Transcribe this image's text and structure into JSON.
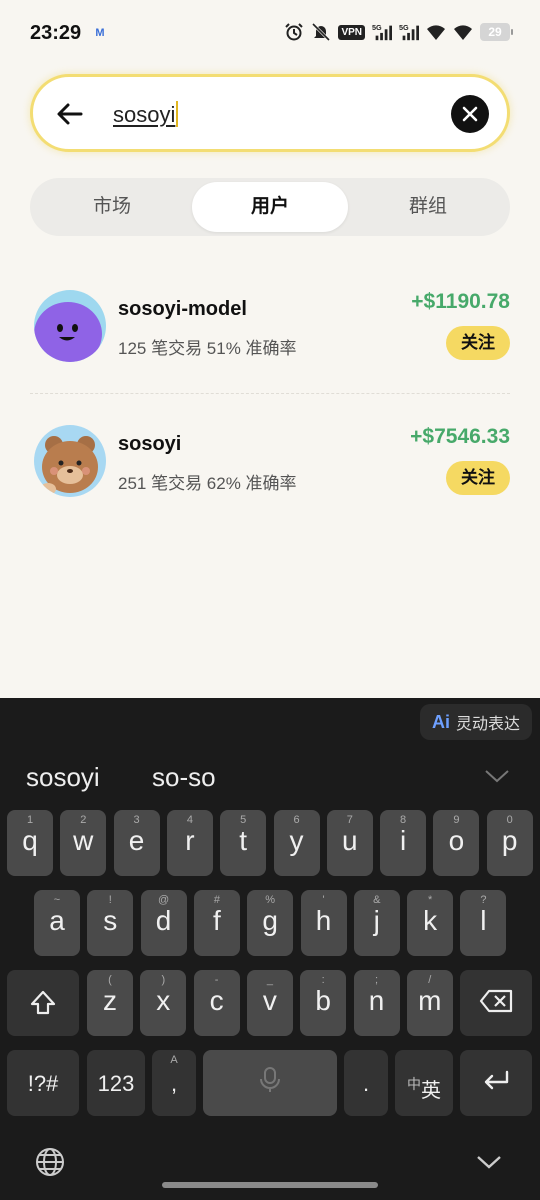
{
  "status_bar": {
    "time": "23:29",
    "mail_badge": "M",
    "vpn_label": "VPN",
    "battery": "29",
    "icons": [
      "alarm-icon",
      "mute-icon",
      "vpn-icon",
      "signal-5g-icon",
      "signal-5g-icon",
      "wifi-icon",
      "wifi-icon",
      "battery-icon"
    ]
  },
  "search": {
    "query": "sosoyi",
    "accent_color": "#f3dd73"
  },
  "tabs": [
    {
      "label": "市场",
      "selected": false
    },
    {
      "label": "用户",
      "selected": true
    },
    {
      "label": "群组",
      "selected": false
    }
  ],
  "users": [
    {
      "name": "sosoyi-model",
      "stats": "125 笔交易 51% 准确率",
      "pnl": "+$1190.78",
      "follow_label": "关注",
      "avatar": "purple-smiley"
    },
    {
      "name": "sosoyi",
      "stats": "251 笔交易 62% 准确率",
      "pnl": "+$7546.33",
      "follow_label": "关注",
      "avatar": "bear-cartoon"
    }
  ],
  "colors": {
    "profit_green": "#47a96a",
    "follow_yellow": "#f5d962",
    "background": "#f8f6f1",
    "keyboard_bg": "#1b1b1b"
  },
  "keyboard": {
    "ai_chip_badge": "Ai",
    "ai_chip_label": "灵动表达",
    "suggestions": [
      "sosoyi",
      "so-so"
    ],
    "row1": [
      {
        "k": "q",
        "h": "1"
      },
      {
        "k": "w",
        "h": "2"
      },
      {
        "k": "e",
        "h": "3"
      },
      {
        "k": "r",
        "h": "4"
      },
      {
        "k": "t",
        "h": "5"
      },
      {
        "k": "y",
        "h": "6"
      },
      {
        "k": "u",
        "h": "7"
      },
      {
        "k": "i",
        "h": "8"
      },
      {
        "k": "o",
        "h": "9"
      },
      {
        "k": "p",
        "h": "0"
      }
    ],
    "row2": [
      {
        "k": "a",
        "h": "~"
      },
      {
        "k": "s",
        "h": "!"
      },
      {
        "k": "d",
        "h": "@"
      },
      {
        "k": "f",
        "h": "#"
      },
      {
        "k": "g",
        "h": "%"
      },
      {
        "k": "h",
        "h": "'"
      },
      {
        "k": "j",
        "h": "&"
      },
      {
        "k": "k",
        "h": "*"
      },
      {
        "k": "l",
        "h": "?"
      }
    ],
    "row3": [
      {
        "k": "z",
        "h": "("
      },
      {
        "k": "x",
        "h": ")"
      },
      {
        "k": "c",
        "h": "-"
      },
      {
        "k": "v",
        "h": "_"
      },
      {
        "k": "b",
        "h": ":"
      },
      {
        "k": "n",
        "h": ";"
      },
      {
        "k": "m",
        "h": "/"
      }
    ],
    "symbols_label": "!?#",
    "numbers_label": "123",
    "comma_label": ",",
    "comma_hint": "A",
    "period_label": ".",
    "lang_switch_top": "中",
    "lang_switch_main": "英"
  }
}
